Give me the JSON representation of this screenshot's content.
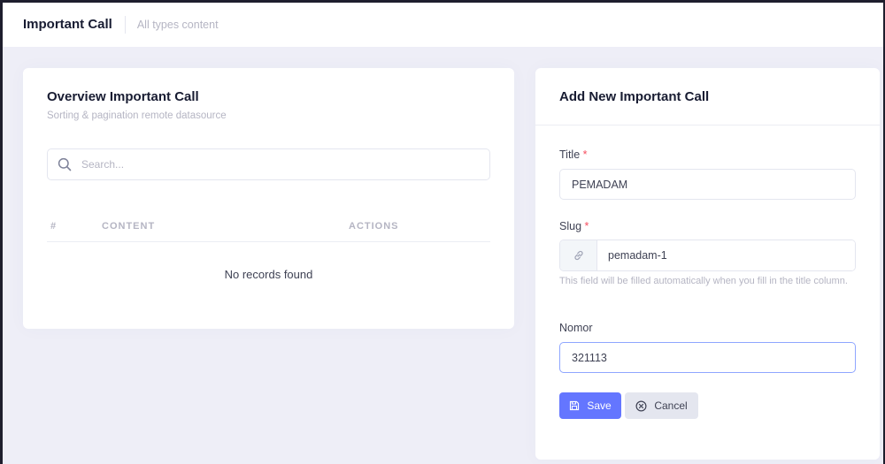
{
  "subheader": {
    "title": "Important Call",
    "description": "All types content"
  },
  "overview": {
    "title": "Overview Important Call",
    "subtitle": "Sorting & pagination remote datasource",
    "search": {
      "placeholder": "Search...",
      "value": ""
    },
    "table": {
      "columns": [
        "#",
        "CONTENT",
        "ACTIONS"
      ],
      "rows": [],
      "empty_message": "No records found"
    }
  },
  "form": {
    "title": "Add New Important Call",
    "title_field": {
      "label": "Title",
      "required_mark": "*",
      "value": "PEMADAM"
    },
    "slug_field": {
      "label": "Slug",
      "required_mark": "*",
      "value": "pemadam-1",
      "help": "This field will be filled automatically when you fill in the title column."
    },
    "nomor_field": {
      "label": "Nomor",
      "value": "321113"
    },
    "save_label": "Save",
    "cancel_label": "Cancel"
  },
  "colors": {
    "primary": "#6476ff",
    "required": "#f64e60",
    "muted": "#b5b5c3",
    "background": "#eeeef7"
  },
  "icons": [
    "search-icon",
    "link-icon",
    "save-icon",
    "cancel-icon"
  ]
}
